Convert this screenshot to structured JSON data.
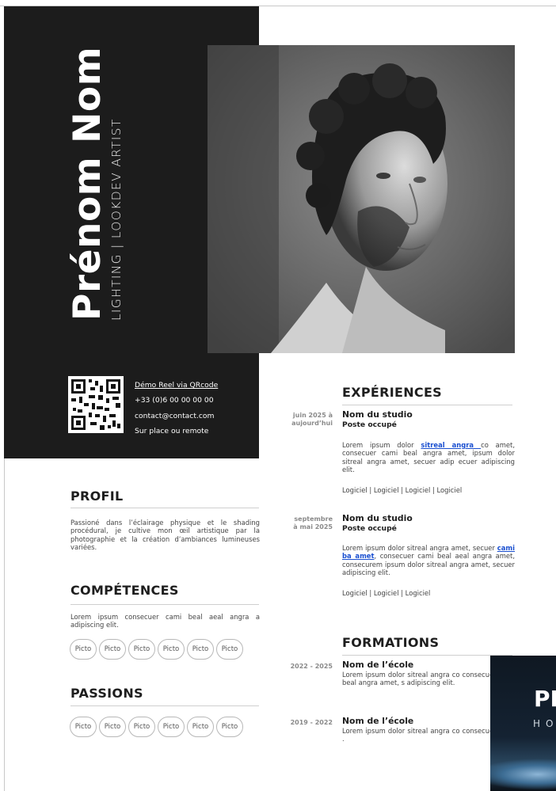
{
  "header": {
    "name": "Prénom Nom",
    "job_title": "LIGHTING | LOOKDEV ARTIST"
  },
  "contact": {
    "demo_reel": "Démo Reel via QRcode",
    "phone": "+33 (0)6 00 00 00 00",
    "email": "contact@contact.com",
    "location": "Sur place ou remote"
  },
  "profil": {
    "title": "PROFIL",
    "text": "Passioné dans l’éclairage physique et le shading procédural, je cultive mon œil artistique par la photographie et la création d’ambiances lumineuses variées."
  },
  "competences": {
    "title": "COMPÉTENCES",
    "text": "Lorem ipsum consecuer cami beal aeal angra a adipiscing elit.",
    "pictos": [
      "Picto",
      "Picto",
      "Picto",
      "Picto",
      "Picto",
      "Picto"
    ]
  },
  "passions": {
    "title": "PASSIONS",
    "pictos": [
      "Picto",
      "Picto",
      "Picto",
      "Picto",
      "Picto",
      "Picto"
    ]
  },
  "experiences": {
    "title": "EXPÉRIENCES",
    "items": [
      {
        "date_line1": "juin 2025 à",
        "date_line2": "aujourd’hui",
        "studio": "Nom du studio",
        "poste": "Poste occupé",
        "text_before": "Lorem ipsum dolor ",
        "link": "sitreal angra ",
        "text_after": "co amet, consecuer cami beal angra amet, ipsum dolor sitreal angra amet, secuer adip ecuer adipiscing elit.",
        "software": "Logiciel | Logiciel | Logiciel | Logiciel"
      },
      {
        "date_line1": "septembre",
        "date_line2": "à mai 2025",
        "studio": "Nom du studio",
        "poste": "Poste occupé",
        "text_before": "Lorem ipsum dolor sitreal angra amet, secuer ",
        "link": "cami ba amet",
        "text_after": ", consecuer cami beal aeal angra amet, consecurem ipsum dolor sitreal angra amet, secuer adipiscing elit.",
        "software": "Logiciel | Logiciel | Logiciel"
      }
    ]
  },
  "formations": {
    "title": "FORMATIONS",
    "items": [
      {
        "date": "2022 - 2025",
        "school": "Nom de l’école",
        "text": "Lorem ipsum dolor sitreal angra co consecuer cami beal angra amet, s adipiscing elit."
      },
      {
        "date": "2019 - 2022",
        "school": "Nom de l’école",
        "text": "Lorem ipsum dolor sitreal angra co consecuer cami ."
      }
    ]
  },
  "thumbnail": {
    "big_text": "PI",
    "small_text": "HO"
  }
}
